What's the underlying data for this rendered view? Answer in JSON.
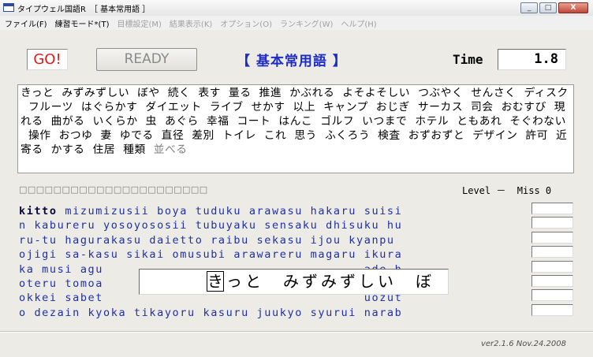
{
  "window": {
    "title": "タイプウェル国語R　［ 基本常用語 ］",
    "buttons": {
      "minimize": "_",
      "maximize": "□",
      "close": "X"
    }
  },
  "menu": [
    {
      "label": "ファイル(F)",
      "enabled": true
    },
    {
      "label": "練習モード*(T)",
      "enabled": true
    },
    {
      "label": "目標設定(M)",
      "enabled": false
    },
    {
      "label": "結果表示(K)",
      "enabled": false
    },
    {
      "label": "オプション(O)",
      "enabled": false
    },
    {
      "label": "ランキング(W)",
      "enabled": false
    },
    {
      "label": "ヘルプ(H)",
      "enabled": false
    }
  ],
  "controls": {
    "go_label": "GO!",
    "ready_label": "READY",
    "mode_label": "【 基本常用語 】",
    "time_label": "Time",
    "time_value": "1.8"
  },
  "words": {
    "list": [
      "きっと",
      "みずみずしい",
      "ぼや",
      "続く",
      "表す",
      "量る",
      "推進",
      "かぶれる",
      "よそよそしい",
      "つぶやく",
      "せんさく",
      "ディスク",
      "フルーツ",
      "はぐらかす",
      "ダイエット",
      "ライブ",
      "せかす",
      "以上",
      "キャンプ",
      "おじぎ",
      "サーカス",
      "司会",
      "おむすび",
      "現れる",
      "曲がる",
      "いくらか",
      "虫",
      "あぐら",
      "幸福",
      "コート",
      "はんこ",
      "ゴルフ",
      "いつまで",
      "ホテル",
      "ともあれ",
      "そぐわない",
      "操作",
      "おつゆ",
      "妻",
      "ゆでる",
      "直径",
      "差別",
      "トイレ",
      "これ",
      "思う",
      "ふくろう",
      "検査",
      "おずおずと",
      "デザイン",
      "許可",
      "近寄る",
      "かする",
      "住居",
      "種類"
    ],
    "tail": "並べる"
  },
  "status": {
    "progress_boxes": "□□□□□□□□□□□□□□□□□□□□□□",
    "level_miss": "Level －  Miss 0"
  },
  "romaji": {
    "typed": "kitto",
    "lines": [
      " mizumizusii boya tuduku arawasu hakaru suisi",
      "n kabureru yosoyososii tubuyaku sensaku dhisuku hu",
      "ru-tu hagurakasu daietto raibu sekasu ijou kyanpu",
      "ojigi sa-kasu sikai omusubi arawareru magaru ikura",
      "ka musi agu                                  ade h",
      "oteru tomoa                                  ru ty",
      "okkei sabet                                  uozut",
      "o dezain kyoka tikayoru kasuru juukyo syurui narab"
    ]
  },
  "typing": {
    "current_char": "き",
    "rest": "っと　みずみずしい　ぼ"
  },
  "footer": {
    "version": "ver2.1.6  Nov.24.2008"
  },
  "colors": {
    "go_text": "#e21a1a",
    "mode_text": "#1d2cc4",
    "romaji_text": "#2030a4"
  }
}
